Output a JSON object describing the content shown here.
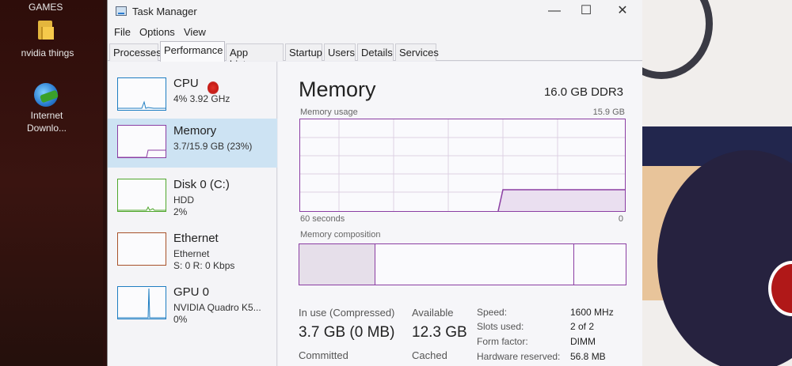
{
  "desktop": {
    "top_label": "GAMES",
    "icons": [
      {
        "name": "folder-icon",
        "label": "nvidia things"
      },
      {
        "name": "internet-download-manager-icon",
        "label_line1": "Internet",
        "label_line2": "Downlo..."
      }
    ]
  },
  "window": {
    "title": "Task Manager",
    "controls": {
      "minimize": "—",
      "maximize": "☐",
      "close": "✕"
    },
    "menu": [
      "File",
      "Options",
      "View"
    ],
    "tabs": [
      "Processes",
      "Performance",
      "App history",
      "Startup",
      "Users",
      "Details",
      "Services"
    ],
    "active_tab": "Performance"
  },
  "resources": [
    {
      "name": "CPU",
      "line1": "4% 3.92 GHz",
      "line2": "",
      "color": "#1f7ec2",
      "selected": false
    },
    {
      "name": "Memory",
      "line1": "3.7/15.9 GB (23%)",
      "line2": "",
      "color": "#8b3ea3",
      "selected": true
    },
    {
      "name": "Disk 0 (C:)",
      "line1": "HDD",
      "line2": "2%",
      "color": "#4fa72c",
      "selected": false
    },
    {
      "name": "Ethernet",
      "line1": "Ethernet",
      "line2": "S: 0 R: 0 Kbps",
      "color": "#a8522a",
      "selected": false
    },
    {
      "name": "GPU 0",
      "line1": "NVIDIA Quadro K5...",
      "line2": "0%",
      "color": "#1f7ec2",
      "selected": false
    }
  ],
  "detail": {
    "title": "Memory",
    "capacity": "16.0 GB DDR3",
    "usage_label": "Memory usage",
    "usage_max": "15.9 GB",
    "time_left": "60 seconds",
    "time_right": "0",
    "composition_label": "Memory composition",
    "in_use_label": "In use (Compressed)",
    "in_use_value": "3.7 GB (0 MB)",
    "available_label": "Available",
    "available_value": "12.3 GB",
    "committed_label": "Committed",
    "cached_label": "Cached",
    "specs": [
      {
        "label": "Speed:",
        "value": "1600 MHz"
      },
      {
        "label": "Slots used:",
        "value": "2 of 2"
      },
      {
        "label": "Form factor:",
        "value": "DIMM"
      },
      {
        "label": "Hardware reserved:",
        "value": "56.8 MB"
      }
    ],
    "accent": "#8b3ea3"
  }
}
